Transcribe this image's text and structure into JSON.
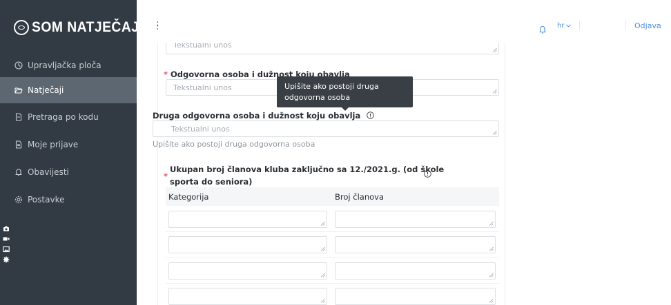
{
  "brand": {
    "logo_text": "SOM NATJEČAJI"
  },
  "sidebar": {
    "items": [
      {
        "label": "Upravljačka ploča",
        "icon": "dashboard-icon"
      },
      {
        "label": "Natječaji",
        "icon": "folder-open-icon",
        "active": true
      },
      {
        "label": "Pretraga po kodu",
        "icon": "document-icon"
      },
      {
        "label": "Moje prijave",
        "icon": "document-text-icon"
      },
      {
        "label": "Obavijesti",
        "icon": "bell-icon"
      },
      {
        "label": "Postavke",
        "icon": "gear-icon"
      }
    ],
    "tools": [
      "camera-icon",
      "video-icon",
      "image-icon",
      "settings-icon"
    ]
  },
  "topbar": {
    "language": "hr",
    "logout_label": "Odjava"
  },
  "form": {
    "top_placeholder": "Tekstualni unos",
    "responsible_label": "Odgovorna osoba i dužnost koju obavlja",
    "responsible_placeholder": "Tekstualni unos",
    "tooltip_text": "Upišite ako postoji druga odgovorna osoba",
    "second_label": "Druga odgovorna osoba i dužnost koju obavlja",
    "second_placeholder": "Tekstualni unos",
    "second_hint": "Upišite ako postoji druga odgovorna osoba",
    "members_label_line1": "Ukupan broj članova kluba zaključno sa 12./2021.g. (od škole",
    "members_label_line2": "sporta do seniora)",
    "table": {
      "col_category": "Kategorija",
      "col_members": "Broj članova"
    }
  },
  "colors": {
    "sidebar_bg": "#323b44",
    "sidebar_active": "#5c6772",
    "accent": "#4a8fe0",
    "required": "#e05a6a",
    "tooltip_bg": "#3a3f45"
  }
}
